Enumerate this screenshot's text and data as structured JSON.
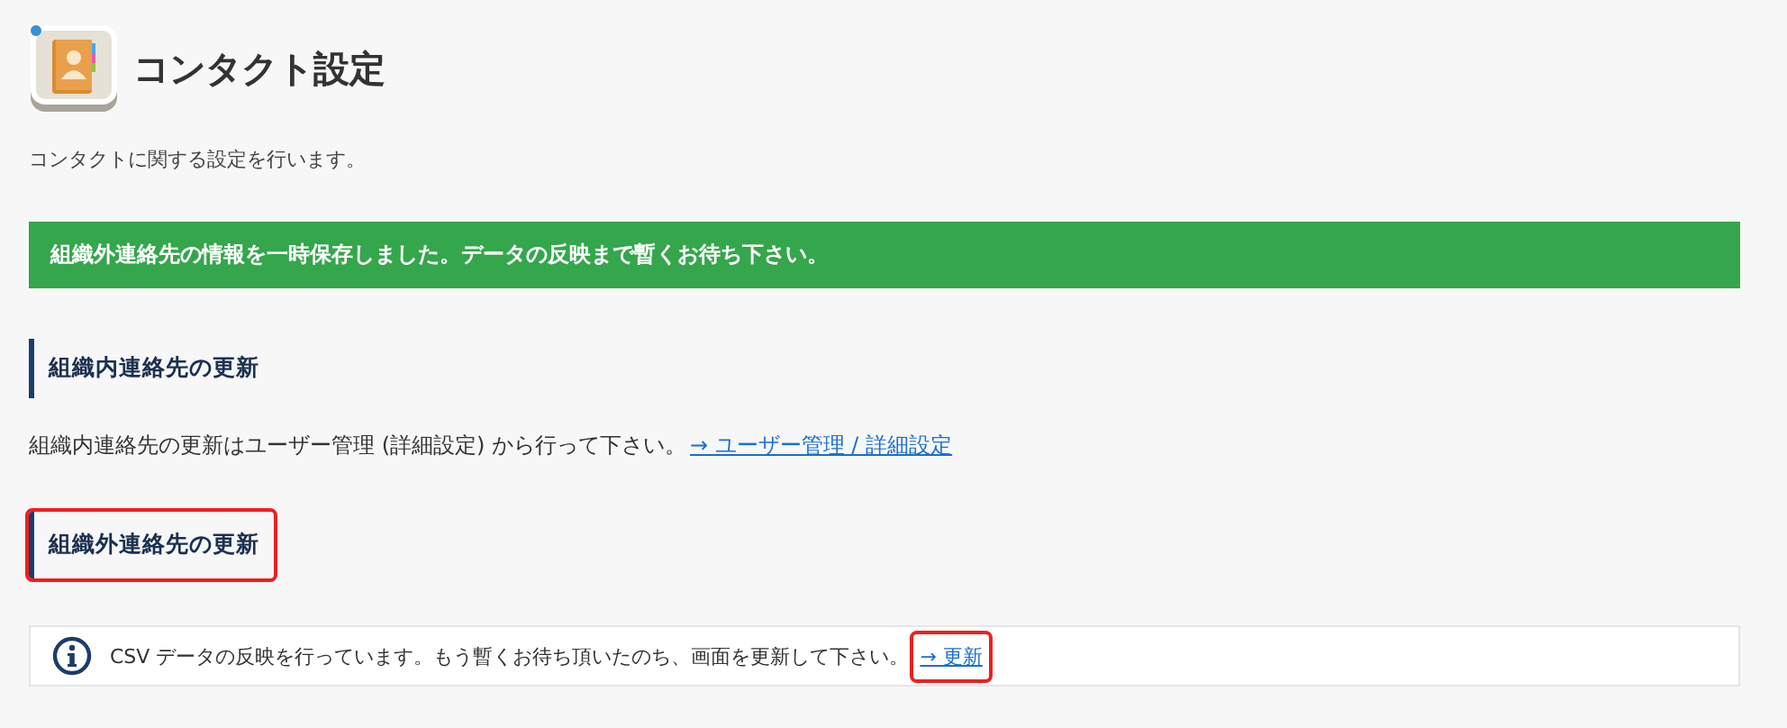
{
  "header": {
    "title": "コンタクト設定",
    "description": "コンタクトに関する設定を行います。"
  },
  "banner": {
    "text": "組織外連絡先の情報を一時保存しました。データの反映まで暫くお待ち下さい。"
  },
  "sections": [
    {
      "heading": "組織内連絡先の更新",
      "highlighted": false,
      "kind": "text",
      "text": "組織内連絡先の更新はユーザー管理 (詳細設定) から行って下さい。",
      "link": {
        "label": "→ ユーザー管理 / 詳細設定",
        "highlighted": false
      }
    },
    {
      "heading": "組織外連絡先の更新",
      "highlighted": true,
      "kind": "info",
      "text": "CSV データの反映を行っています。もう暫くお待ち頂いたのち、画面を更新して下さい。",
      "link": {
        "label": "→ 更新",
        "highlighted": true
      }
    }
  ]
}
